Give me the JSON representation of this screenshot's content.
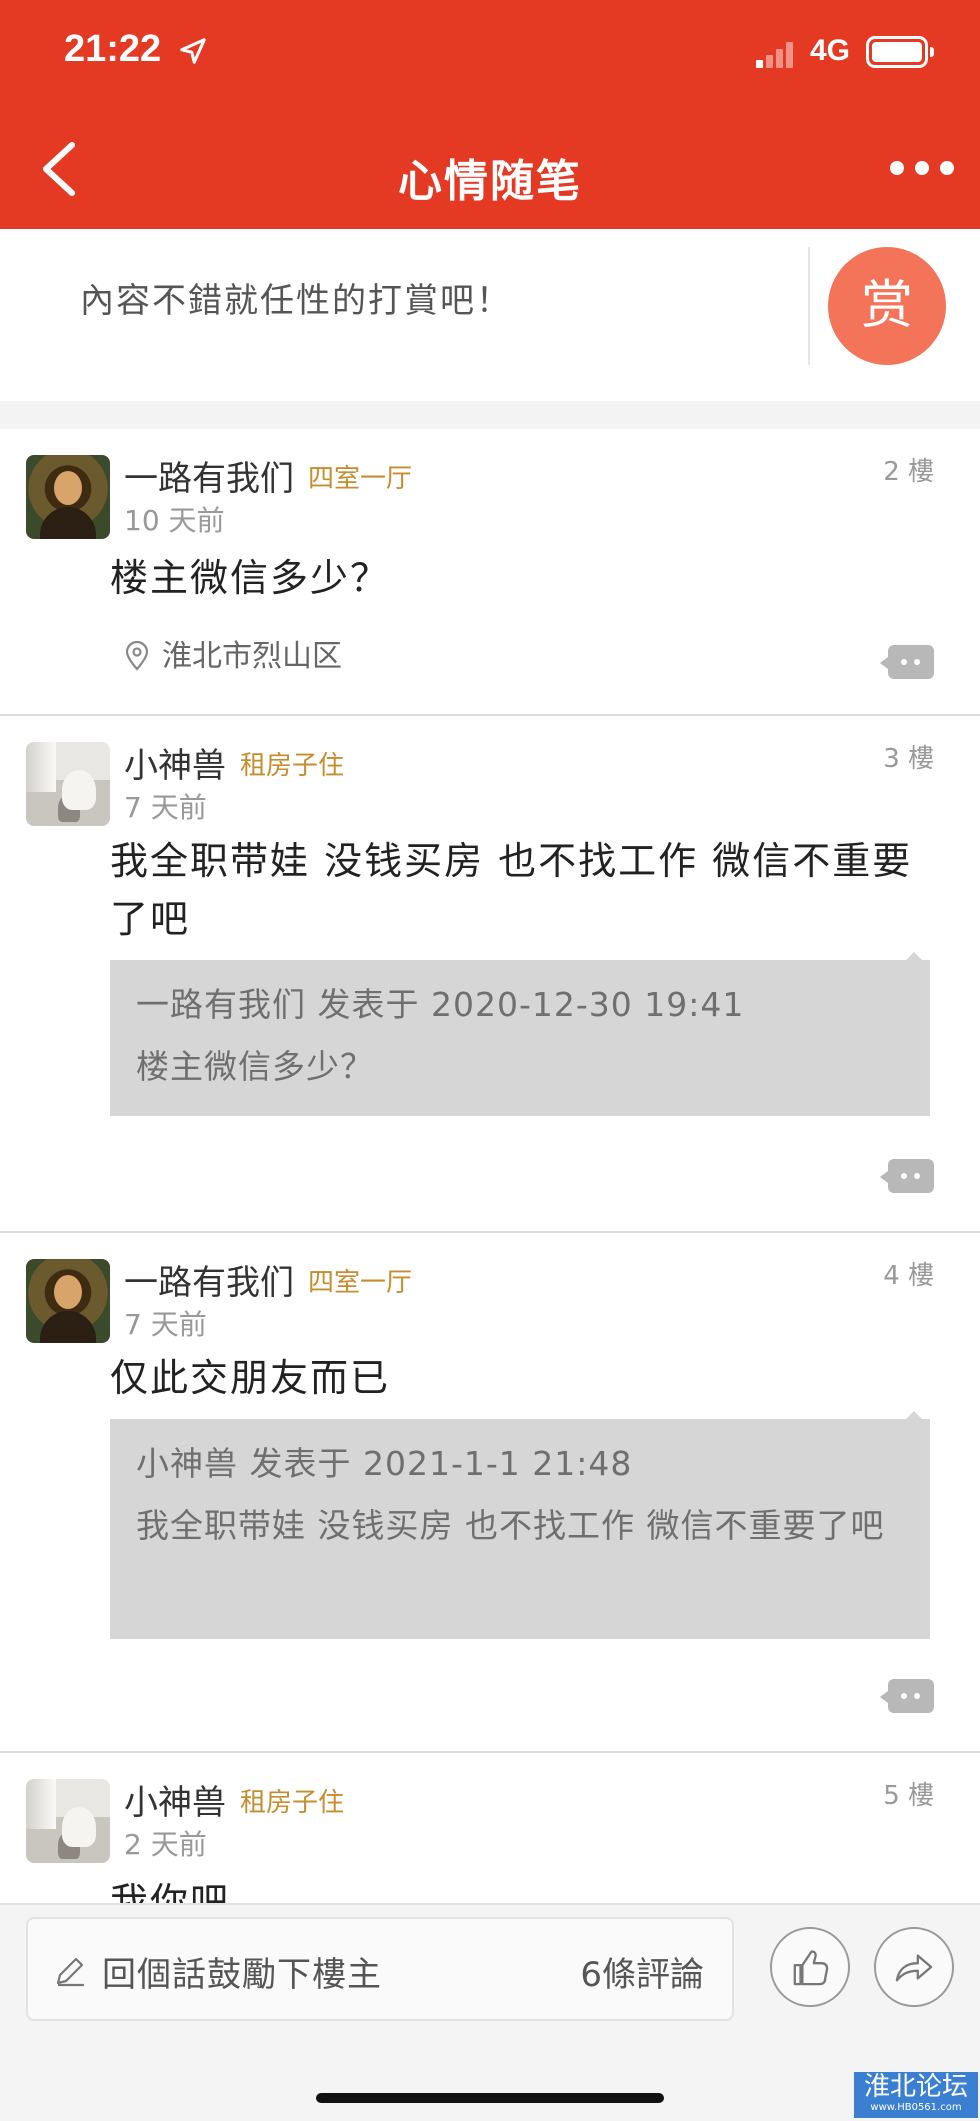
{
  "status_bar": {
    "time": "21:22",
    "network": "4G"
  },
  "header": {
    "title": "心情随笔"
  },
  "reward": {
    "prompt": "內容不錯就任性的打賞吧！",
    "button_label": "赏"
  },
  "posts": [
    {
      "username": "一路有我们",
      "badge": "四室一厅",
      "time": "10 天前",
      "floor": "2 樓",
      "content": "楼主微信多少？",
      "location": "淮北市烈山区"
    },
    {
      "username": "小神兽",
      "badge": "租房子住",
      "time": "7 天前",
      "floor": "3 樓",
      "content": "我全职带娃 没钱买房 也不找工作 微信不重要了吧",
      "quote": {
        "header": "一路有我们 发表于 2020-12-30 19:41",
        "body": "楼主微信多少？"
      }
    },
    {
      "username": "一路有我们",
      "badge": "四室一厅",
      "time": "7 天前",
      "floor": "4 樓",
      "content": "仅此交朋友而已",
      "quote": {
        "header": "小神兽 发表于 2021-1-1 21:48",
        "body": "我全职带娃 没钱买房 也不找工作 微信不重要了吧"
      }
    },
    {
      "username": "小神兽",
      "badge": "租房子住",
      "time": "2 天前",
      "floor": "5 樓",
      "content": "我你吧"
    }
  ],
  "bottom_bar": {
    "comment_placeholder": "回個話鼓勵下樓主",
    "comment_count": "6條評論"
  },
  "watermark": {
    "line1": "淮北论坛",
    "line2": "www.HB0561.com"
  },
  "colors": {
    "header_bg": "#e43a23",
    "reward_btn": "#f4745a",
    "badge": "#c68d2e"
  }
}
